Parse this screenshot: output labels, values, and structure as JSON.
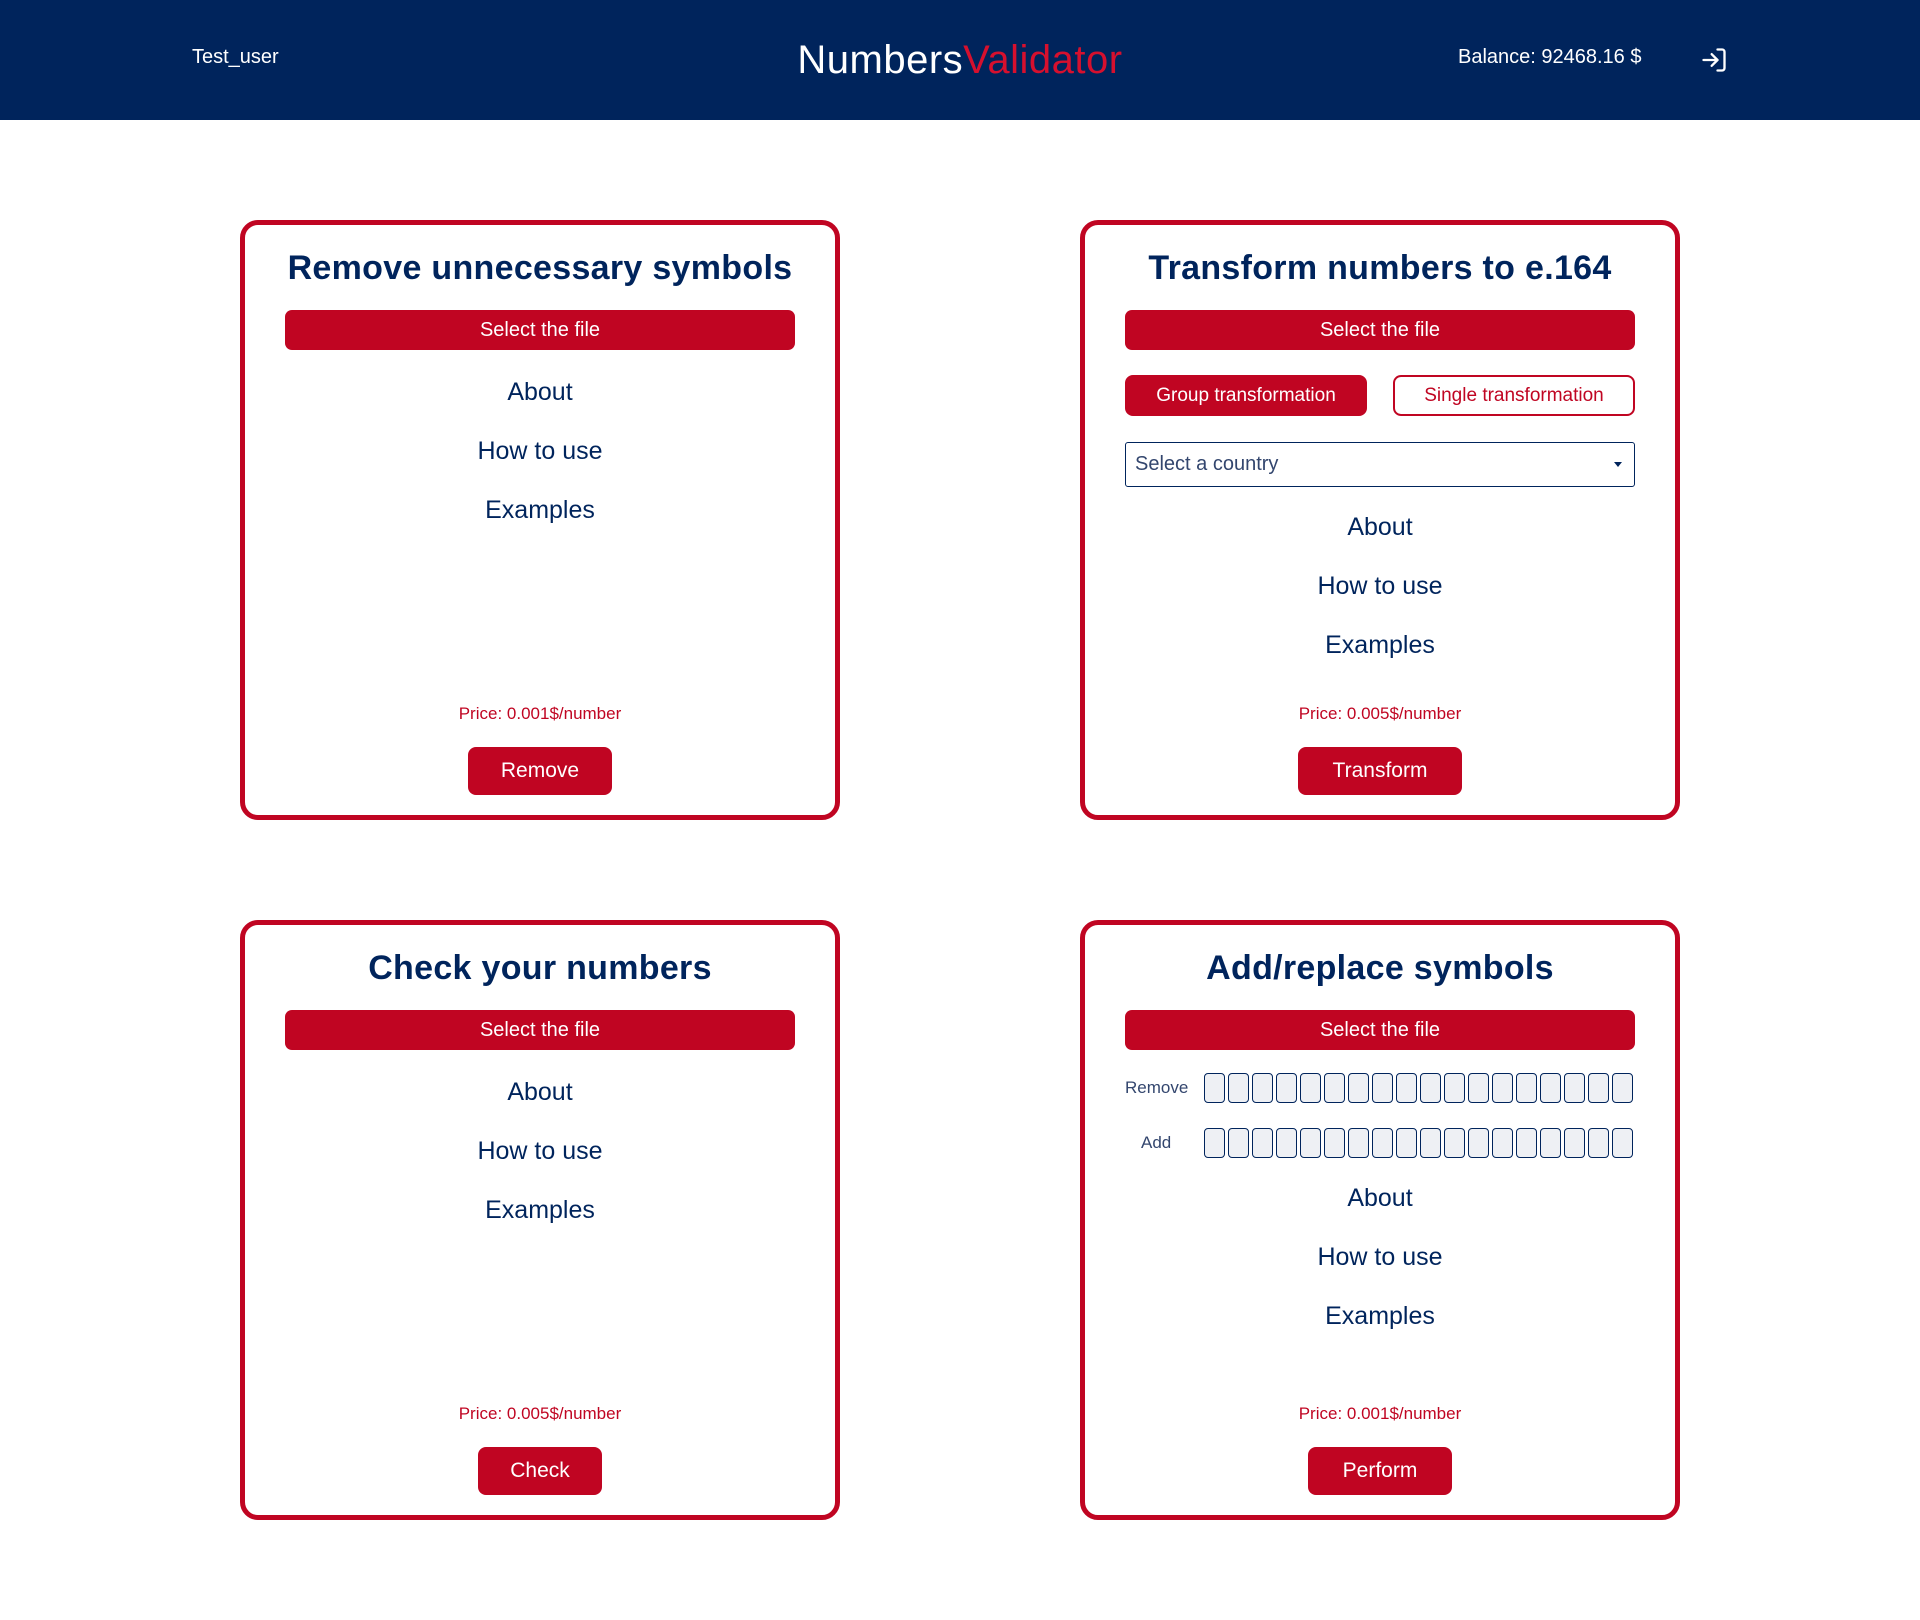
{
  "header": {
    "user": "Test_user",
    "logo_part1": "Numbers",
    "logo_part2": "Validator",
    "balance": "Balance: 92468.16 $",
    "logout_icon": "logout-icon"
  },
  "colors": {
    "navy": "#00245c",
    "accent_red": "#c00522",
    "logo_red": "#d6102e"
  },
  "cards": {
    "remove": {
      "title": "Remove unnecessary symbols",
      "select_file": "Select the file",
      "about": "About",
      "how_to_use": "How to use",
      "examples": "Examples",
      "price": "Price: 0.001$/number",
      "action": "Remove"
    },
    "transform": {
      "title": "Transform numbers to e.164",
      "select_file": "Select the file",
      "tab_group": "Group transformation",
      "tab_single": "Single transformation",
      "country_placeholder": "Select a country",
      "about": "About",
      "how_to_use": "How to use",
      "examples": "Examples",
      "price": "Price: 0.005$/number",
      "action": "Transform"
    },
    "check": {
      "title": "Check your numbers",
      "select_file": "Select the file",
      "about": "About",
      "how_to_use": "How to use",
      "examples": "Examples",
      "price": "Price: 0.005$/number",
      "action": "Check"
    },
    "replace": {
      "title": "Add/replace symbols",
      "select_file": "Select the file",
      "remove_label": "Remove",
      "add_label": "Add",
      "about": "About",
      "how_to_use": "How to use",
      "examples": "Examples",
      "price": "Price: 0.001$/number",
      "action": "Perform"
    }
  }
}
